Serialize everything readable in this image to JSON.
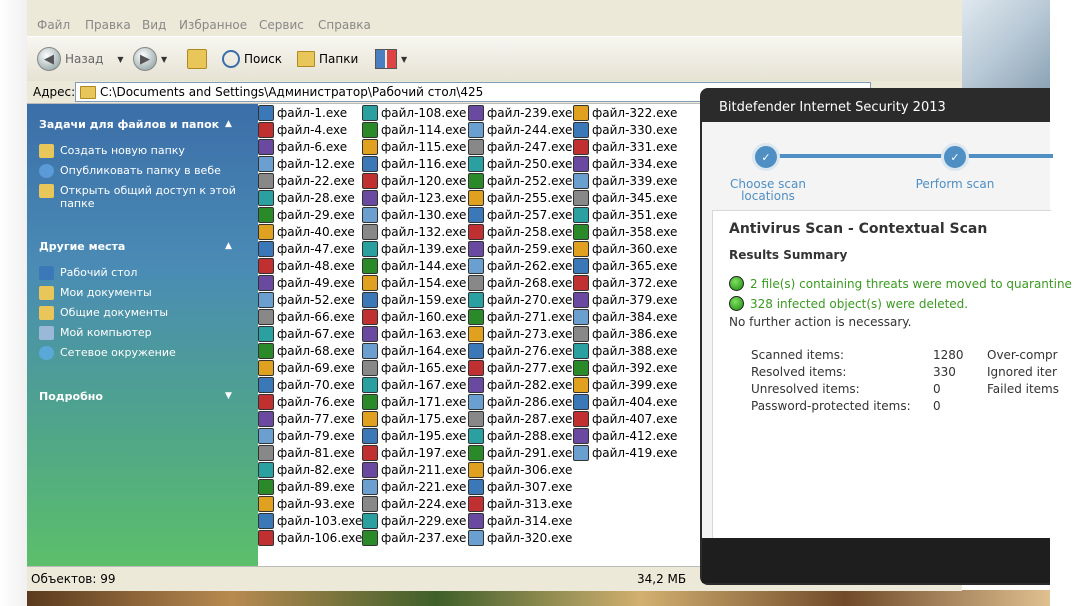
{
  "menu": [
    "Файл",
    "Правка",
    "Вид",
    "Избранное",
    "Сервис",
    "Справка"
  ],
  "toolbar": {
    "back": "Назад",
    "search": "Поиск",
    "folders": "Папки"
  },
  "address": {
    "label": "Адрес:",
    "path": "C:\\Documents and Settings\\Администратор\\Рабочий стол\\425"
  },
  "tasks": {
    "title": "Задачи для файлов и папок",
    "items": [
      "Создать новую папку",
      "Опубликовать папку в вебе",
      "Открыть общий доступ к этой папке"
    ]
  },
  "places": {
    "title": "Другие места",
    "items": [
      "Рабочий стол",
      "Мои документы",
      "Общие документы",
      "Мой компьютер",
      "Сетевое окружение"
    ]
  },
  "details": {
    "title": "Подробно"
  },
  "files": {
    "col1": [
      "файл-1.exe",
      "файл-4.exe",
      "файл-6.exe",
      "файл-12.exe",
      "файл-22.exe",
      "файл-28.exe",
      "файл-29.exe",
      "файл-40.exe",
      "файл-47.exe",
      "файл-48.exe",
      "файл-49.exe",
      "файл-52.exe",
      "файл-66.exe",
      "файл-67.exe",
      "файл-68.exe",
      "файл-69.exe",
      "файл-70.exe",
      "файл-76.exe",
      "файл-77.exe",
      "файл-79.exe",
      "файл-81.exe",
      "файл-82.exe",
      "файл-89.exe",
      "файл-93.exe",
      "файл-103.exe",
      "файл-106.exe"
    ],
    "col2": [
      "файл-108.exe",
      "файл-114.exe",
      "файл-115.exe",
      "файл-116.exe",
      "файл-120.exe",
      "файл-123.exe",
      "файл-130.exe",
      "файл-132.exe",
      "файл-139.exe",
      "файл-144.exe",
      "файл-154.exe",
      "файл-159.exe",
      "файл-160.exe",
      "файл-163.exe",
      "файл-164.exe",
      "файл-165.exe",
      "файл-167.exe",
      "файл-171.exe",
      "файл-175.exe",
      "файл-195.exe",
      "файл-197.exe",
      "файл-211.exe",
      "файл-221.exe",
      "файл-224.exe",
      "файл-229.exe",
      "файл-237.exe"
    ],
    "col3": [
      "файл-239.exe",
      "файл-244.exe",
      "файл-247.exe",
      "файл-250.exe",
      "файл-252.exe",
      "файл-255.exe",
      "файл-257.exe",
      "файл-258.exe",
      "файл-259.exe",
      "файл-262.exe",
      "файл-268.exe",
      "файл-270.exe",
      "файл-271.exe",
      "файл-273.exe",
      "файл-276.exe",
      "файл-277.exe",
      "файл-282.exe",
      "файл-286.exe",
      "файл-287.exe",
      "файл-288.exe",
      "файл-291.exe",
      "файл-306.exe",
      "файл-307.exe",
      "файл-313.exe",
      "файл-314.exe",
      "файл-320.exe"
    ],
    "col4": [
      "файл-322.exe",
      "файл-330.exe",
      "файл-331.exe",
      "файл-334.exe",
      "файл-339.exe",
      "файл-345.exe",
      "файл-351.exe",
      "файл-358.exe",
      "файл-360.exe",
      "файл-365.exe",
      "файл-372.exe",
      "файл-379.exe",
      "файл-384.exe",
      "файл-386.exe",
      "файл-388.exe",
      "файл-392.exe",
      "файл-399.exe",
      "файл-404.exe",
      "файл-407.exe",
      "файл-412.exe",
      "файл-419.exe"
    ]
  },
  "status": {
    "objects": "Объектов: 99",
    "size": "34,2 МБ"
  },
  "bitdefender": {
    "title": "Bitdefender Internet Security 2013",
    "steps": [
      "Choose scan locations",
      "Perform scan"
    ],
    "scan_title": "Antivirus Scan - Contextual Scan",
    "results_summary": "Results Summary",
    "result1": "2 file(s) containing threats were moved to quarantine",
    "result2": "328 infected object(s) were deleted.",
    "note": "No further action is necessary.",
    "stats": [
      {
        "label": "Scanned items:",
        "value": "1280"
      },
      {
        "label": "Resolved items:",
        "value": "330"
      },
      {
        "label": "Unresolved items:",
        "value": "0"
      },
      {
        "label": "Password-protected items:",
        "value": "0"
      }
    ],
    "stats_right": [
      "Over-compr",
      "Ignored iter",
      "Failed items"
    ],
    "accent": "#4f8fc3",
    "success": "#3a9a20"
  }
}
